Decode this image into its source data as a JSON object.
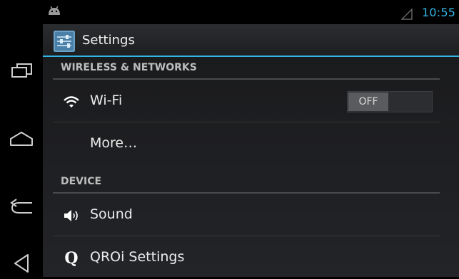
{
  "status_bar": {
    "time": "10:55",
    "notification_icon": "android-icon",
    "signal_icon": "signal-icon"
  },
  "action_bar": {
    "title": "Settings",
    "icon": "settings-app-icon"
  },
  "navigation": {
    "buttons": [
      {
        "name": "recent-apps-icon"
      },
      {
        "name": "home-icon"
      },
      {
        "name": "back-icon"
      },
      {
        "name": "menu-icon"
      }
    ]
  },
  "sections": [
    {
      "header": "WIRELESS & NETWORKS",
      "items": [
        {
          "label": "Wi-Fi",
          "icon": "wifi-icon",
          "toggle": "OFF"
        },
        {
          "label": "More…",
          "icon": null
        }
      ]
    },
    {
      "header": "DEVICE",
      "items": [
        {
          "label": "Sound",
          "icon": "sound-icon"
        },
        {
          "label": "QROi Settings",
          "icon": "qroi-icon",
          "icon_glyph": "Q"
        }
      ]
    }
  ],
  "colors": {
    "accent": "#33b5e5",
    "background": "#000000",
    "content_background": "#1d1e21"
  }
}
